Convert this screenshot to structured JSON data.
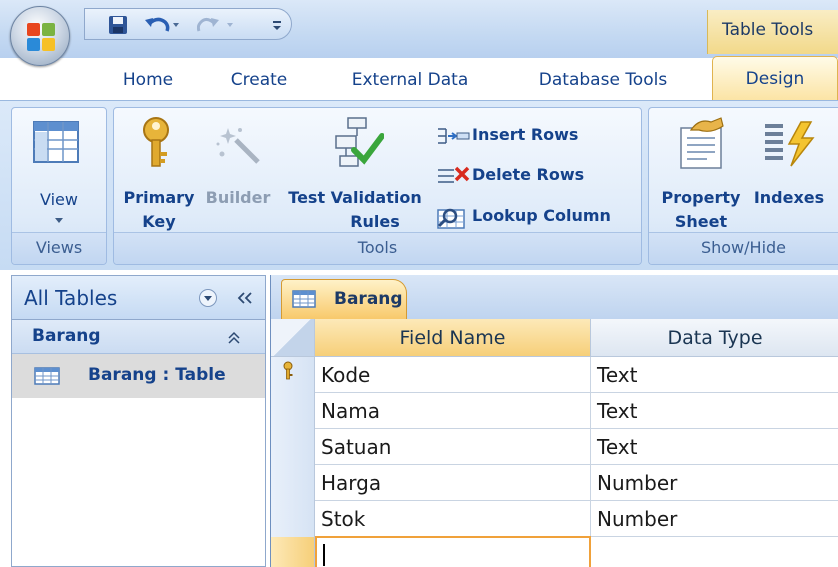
{
  "title_bar": {
    "contextual_tab_label": "Table Tools"
  },
  "ribbon_tabs": [
    {
      "label": "Home"
    },
    {
      "label": "Create"
    },
    {
      "label": "External Data"
    },
    {
      "label": "Database Tools"
    },
    {
      "label": "Design",
      "active": true
    }
  ],
  "groups": {
    "views": {
      "label": "Views",
      "view_button": "View"
    },
    "tools": {
      "label": "Tools",
      "primary_key_line1": "Primary",
      "primary_key_line2": "Key",
      "builder": "Builder",
      "test_validation_line1": "Test Validation",
      "test_validation_line2": "Rules",
      "insert_rows": "Insert Rows",
      "delete_rows": "Delete Rows",
      "lookup_column": "Lookup Column"
    },
    "show_hide": {
      "label": "Show/Hide",
      "property_sheet_line1": "Property",
      "property_sheet_line2": "Sheet",
      "indexes": "Indexes"
    }
  },
  "nav_pane": {
    "header": "All Tables",
    "group": "Barang",
    "item": "Barang : Table"
  },
  "document": {
    "tab_label": "Barang",
    "columns": [
      "Field Name",
      "Data Type"
    ],
    "rows": [
      {
        "field": "Kode",
        "type": "Text",
        "primary_key": true
      },
      {
        "field": "Nama",
        "type": "Text"
      },
      {
        "field": "Satuan",
        "type": "Text"
      },
      {
        "field": "Harga",
        "type": "Number"
      },
      {
        "field": "Stok",
        "type": "Number"
      }
    ]
  },
  "colors": {
    "accent_text": "#15428b",
    "active_tab": "#fbe3a2",
    "ribbon_bg": "#c6dbf3"
  }
}
